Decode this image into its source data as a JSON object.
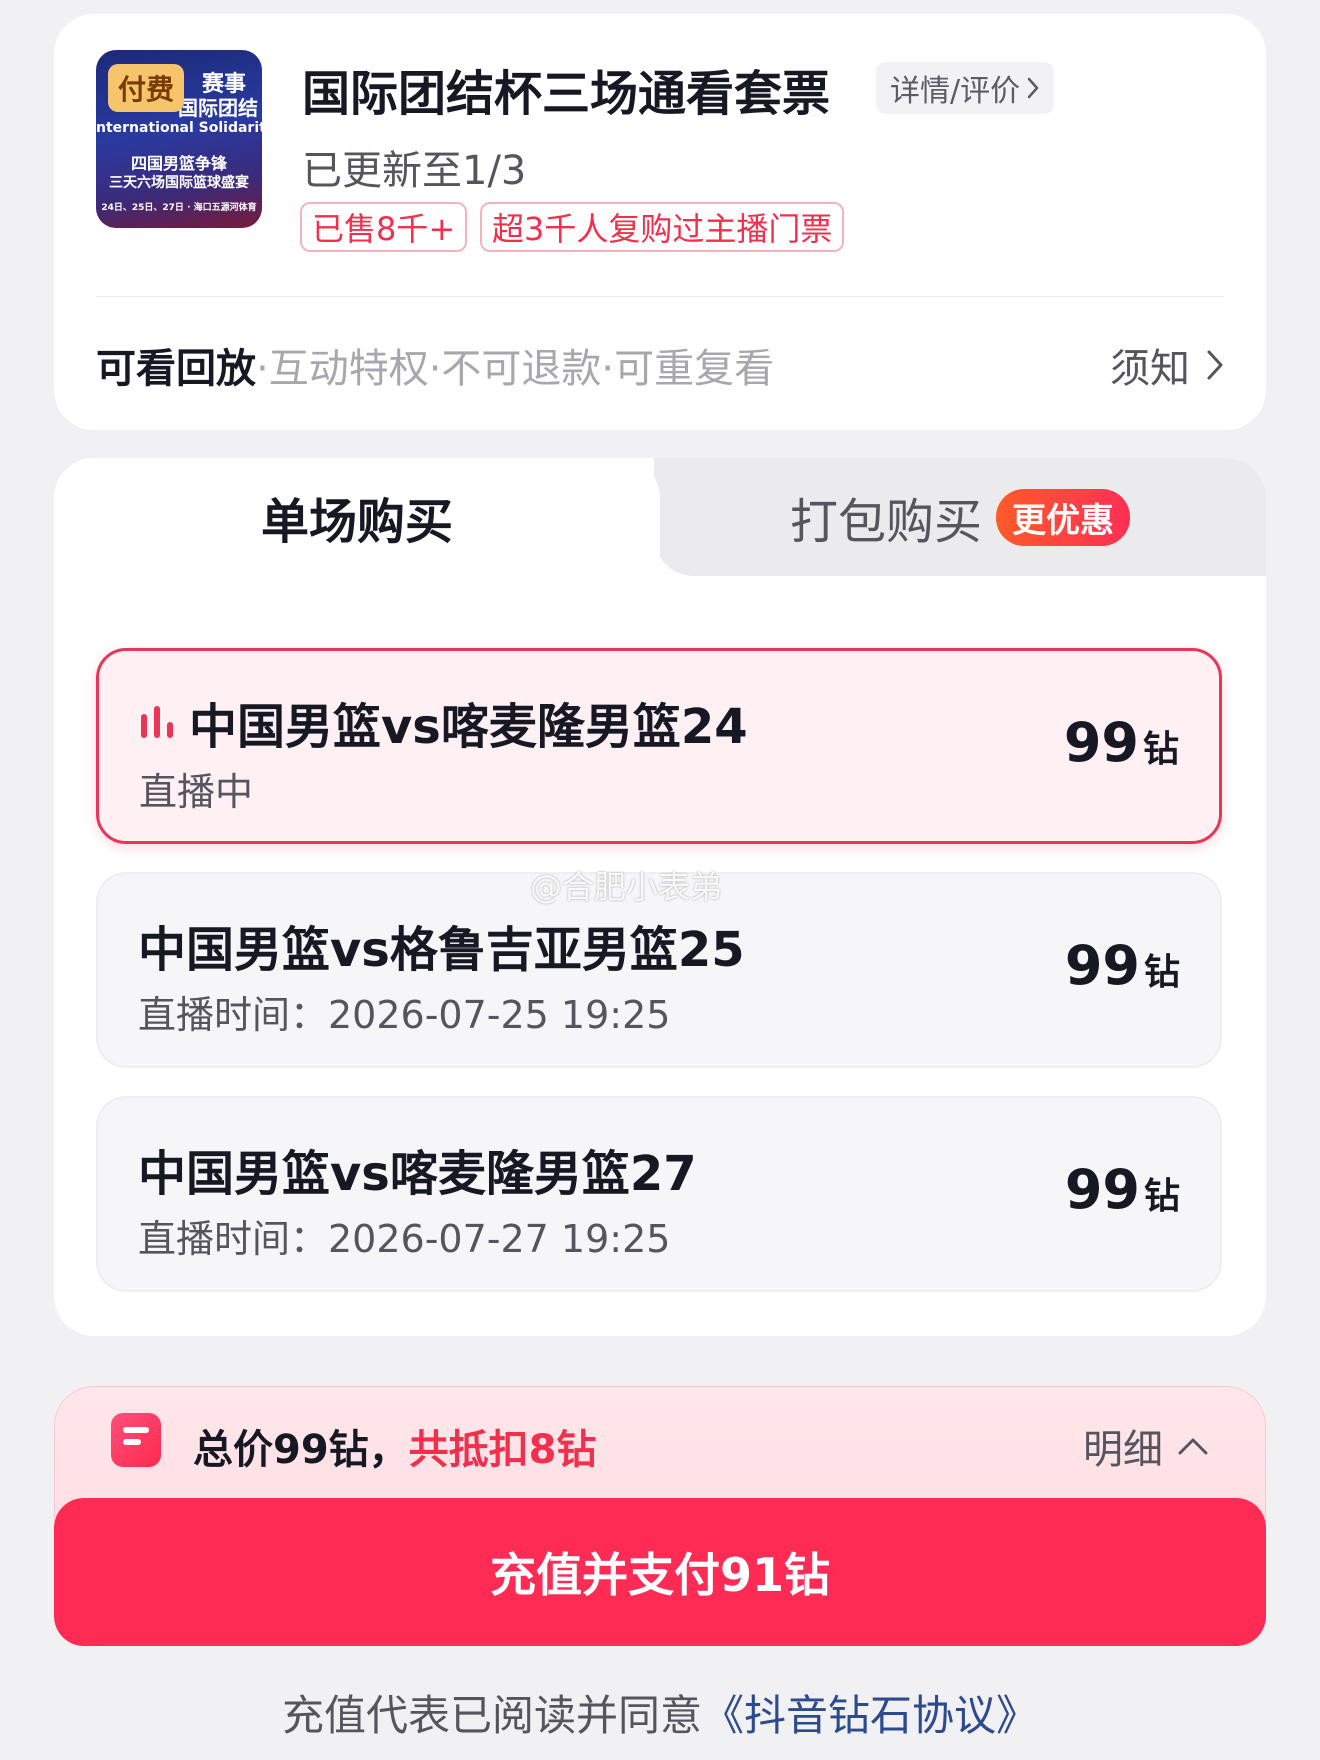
{
  "header": {
    "thumbnail_badge": "付费",
    "thumbnail_lines": [
      "赛事",
      "国际团结",
      "nternational Solidarity Cu",
      "四国男篮争锋",
      "三天六场国际篮球盛宴",
      "24日、25日、27日 · 海口五源河体育"
    ],
    "title": "国际团结杯三场通看套票",
    "detail_label": "详情/评价",
    "update_status": "已更新至1/3",
    "tags": [
      "已售8千+",
      "超3千人复购过主播门票"
    ],
    "feature_strong": "可看回放",
    "feature_rest": "·互动特权·不可退款·可重复看",
    "notice_label": "须知"
  },
  "tabs": {
    "single": "单场购买",
    "bundle": "打包购买",
    "bundle_badge": "更优惠"
  },
  "sessions": [
    {
      "name": "中国男篮vs喀麦隆男篮24",
      "sub": "直播中",
      "price": "99",
      "unit": "钻",
      "active": true
    },
    {
      "name": "中国男篮vs格鲁吉亚男篮25",
      "sub": "直播时间：2026-07-25 19:25",
      "price": "99",
      "unit": "钻",
      "active": false
    },
    {
      "name": "中国男篮vs喀麦隆男篮27",
      "sub": "直播时间：2026-07-27 19:25",
      "price": "99",
      "unit": "钻",
      "active": false
    }
  ],
  "watermark": "@合肥小表弟",
  "summary": {
    "total": "总价99钻，",
    "deduct": "共抵扣8钻",
    "breakdown": "明细"
  },
  "pay_button": "充值并支付91钻",
  "agreement": {
    "prefix": "充值代表已阅读并同意",
    "link": "《抖音钻石协议》"
  },
  "colors": {
    "accent": "#fe2c55",
    "tag_red": "#f0304d",
    "active_border": "#e8365a"
  },
  "icons": {
    "live": "live-bars-icon",
    "chevron_right": "chevron-right-icon",
    "chevron_up": "chevron-up-icon",
    "app_logo": "douyin-pay-icon"
  }
}
